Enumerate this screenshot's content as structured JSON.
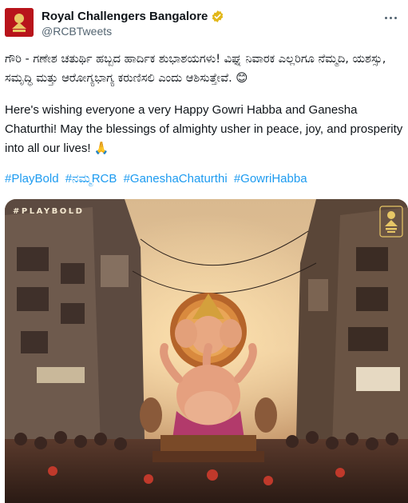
{
  "account": {
    "name": "Royal Challengers Bangalore",
    "handle": "@RCBTweets",
    "verified": true,
    "avatar_color": "#b8141b"
  },
  "tweet": {
    "kannada_text": "ಗೌರಿ - ಗಣೇಶ ಚತುರ್ಥಿ ಹಬ್ಬದ ಹಾರ್ದಿಕ ಶುಭಾಶಯಗಳು! ವಿಘ್ನ ನಿವಾರಕ ಎಲ್ಲರಿಗೂ ನೆಮ್ಮದಿ, ಯಶಸ್ಸು, ಸಮೃದ್ಧಿ ಮತ್ತು ಆರೋಗ್ಯಭಾಗ್ಯ ಕರುಣಿಸಲಿ ಎಂದು ಆಶಿಸುತ್ತೇವೆ. 😊",
    "english_text": "Here's wishing everyone a very Happy Gowri Habba and Ganesha Chaturthi! May the blessings of almighty usher in peace, joy, and prosperity into all our lives! 🙏",
    "hashtags": [
      "#PlayBold",
      "#ನಮ್ಮRCB",
      "#GaneshaChaturthi",
      "#GowriHabba"
    ],
    "link_color": "#1d9bf0"
  },
  "media": {
    "overlay_text": "#PLAYBOLD",
    "icons": {
      "more": "more-options-icon",
      "verified": "verified-badge-icon",
      "logo": "rcb-logo-icon"
    }
  }
}
